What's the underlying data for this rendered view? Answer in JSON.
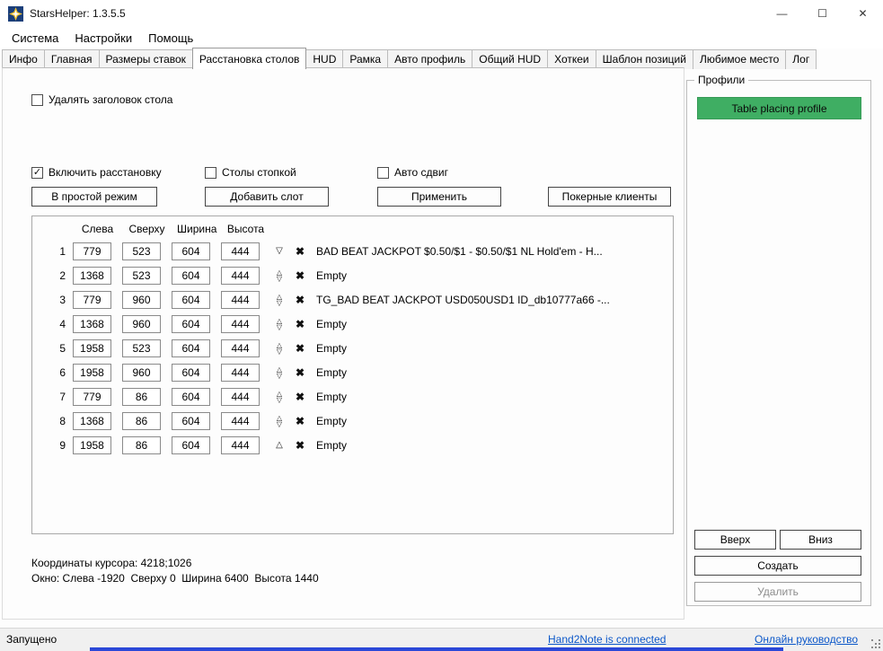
{
  "window": {
    "title": "StarsHelper: 1.3.5.5",
    "controls": {
      "minimize": "—",
      "maximize": "☐",
      "close": "✕"
    }
  },
  "menu": {
    "items": [
      "Система",
      "Настройки",
      "Помощь"
    ]
  },
  "tabs": {
    "items": [
      "Инфо",
      "Главная",
      "Размеры ставок",
      "Расстановка столов",
      "HUD",
      "Рамка",
      "Авто профиль",
      "Общий HUD",
      "Хоткеи",
      "Шаблон позиций",
      "Любимое место",
      "Лог"
    ],
    "active": "Расстановка столов"
  },
  "icons": {
    "check": "✓",
    "up": "△",
    "down": "▽",
    "delete": "✖"
  },
  "colors": {
    "profile_green": "#3fae63",
    "bottom_strip": "#2b48d8",
    "link_blue": "#0b57c9"
  },
  "main": {
    "remove_title_checkbox": "Удалять заголовок стола",
    "enable_checkbox": "Включить расстановку",
    "stack_checkbox": "Столы стопкой",
    "autoshift_checkbox": "Авто сдвиг",
    "buttons": {
      "simple_mode": "В простой режим",
      "add_slot": "Добавить слот",
      "apply": "Применить",
      "poker_clients": "Покерные клиенты"
    },
    "columns": {
      "left": "Слева",
      "top": "Сверху",
      "width": "Ширина",
      "height": "Высота"
    },
    "rows": [
      {
        "index": "1",
        "left": "779",
        "top": "523",
        "width": "604",
        "height": "444",
        "arrows": "down",
        "label": "BAD BEAT JACKPOT $0.50/$1 - $0.50/$1 NL Hold'em - H..."
      },
      {
        "index": "2",
        "left": "1368",
        "top": "523",
        "width": "604",
        "height": "444",
        "arrows": "both",
        "label": "Empty"
      },
      {
        "index": "3",
        "left": "779",
        "top": "960",
        "width": "604",
        "height": "444",
        "arrows": "both",
        "label": "TG_BAD BEAT JACKPOT USD050USD1 ID_db10777a66 -..."
      },
      {
        "index": "4",
        "left": "1368",
        "top": "960",
        "width": "604",
        "height": "444",
        "arrows": "both",
        "label": "Empty"
      },
      {
        "index": "5",
        "left": "1958",
        "top": "523",
        "width": "604",
        "height": "444",
        "arrows": "both",
        "label": "Empty"
      },
      {
        "index": "6",
        "left": "1958",
        "top": "960",
        "width": "604",
        "height": "444",
        "arrows": "both",
        "label": "Empty"
      },
      {
        "index": "7",
        "left": "779",
        "top": "86",
        "width": "604",
        "height": "444",
        "arrows": "both",
        "label": "Empty"
      },
      {
        "index": "8",
        "left": "1368",
        "top": "86",
        "width": "604",
        "height": "444",
        "arrows": "both",
        "label": "Empty"
      },
      {
        "index": "9",
        "left": "1958",
        "top": "86",
        "width": "604",
        "height": "444",
        "arrows": "up",
        "label": "Empty"
      }
    ],
    "cursor_coords": "Координаты курсора: 4218;1026",
    "window_info": "Окно: Слева -1920  Сверху 0  Ширина 6400  Высота 1440"
  },
  "profiles": {
    "title": "Профили",
    "profile_button": "Table placing profile",
    "buttons": {
      "up": "Вверх",
      "down": "Вниз",
      "create": "Создать",
      "delete": "Удалить"
    }
  },
  "statusbar": {
    "left": "Запущено",
    "center_link": "Hand2Note is connected",
    "right_link": "Онлайн руководство"
  }
}
